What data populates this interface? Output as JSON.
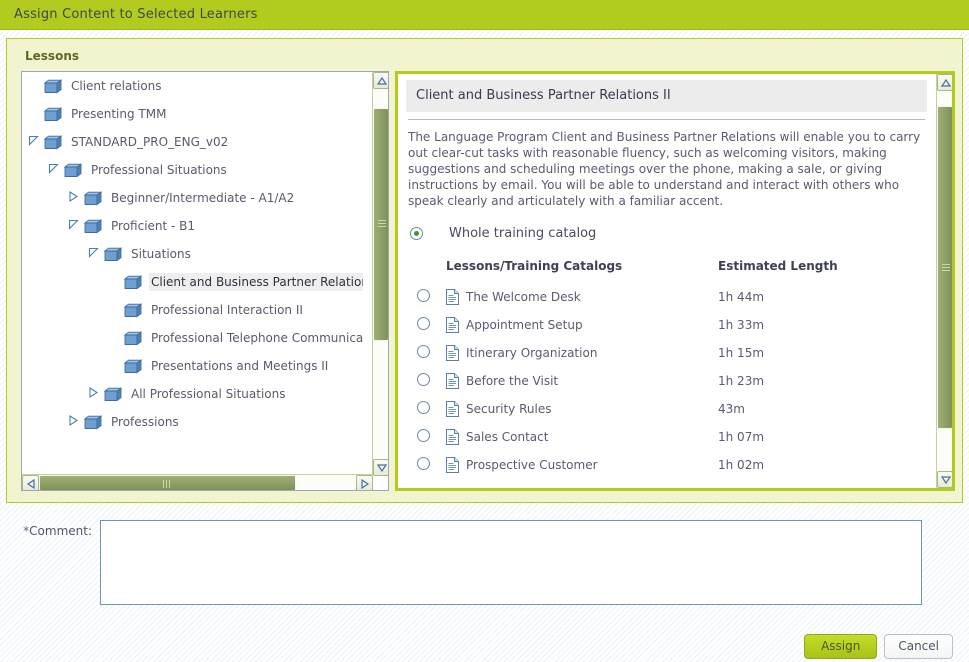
{
  "window": {
    "title": "Assign Content to Selected Learners",
    "title_bg": "#b3ca1f"
  },
  "panel": {
    "legend": "Lessons",
    "bg": "#f1f4cf",
    "border": "#b3ca1f"
  },
  "tree": {
    "items": [
      {
        "label": "Client relations",
        "depth": 1,
        "twisty": "none",
        "selected": false,
        "icon": "folder-icon"
      },
      {
        "label": "Presenting TMM",
        "depth": 1,
        "twisty": "none",
        "selected": false,
        "icon": "folder-icon"
      },
      {
        "label": "STANDARD_PRO_ENG_v02",
        "depth": 1,
        "twisty": "expanded",
        "selected": false,
        "icon": "folder-icon"
      },
      {
        "label": "Professional Situations",
        "depth": 2,
        "twisty": "expanded",
        "selected": false,
        "icon": "folder-icon"
      },
      {
        "label": "Beginner/Intermediate - A1/A2",
        "depth": 3,
        "twisty": "collapsed",
        "selected": false,
        "icon": "folder-icon"
      },
      {
        "label": "Proficient - B1",
        "depth": 3,
        "twisty": "expanded",
        "selected": false,
        "icon": "folder-icon"
      },
      {
        "label": "Situations",
        "depth": 4,
        "twisty": "expanded",
        "selected": false,
        "icon": "folder-icon"
      },
      {
        "label": "Client and Business Partner Relations II",
        "depth": 5,
        "twisty": "none",
        "selected": true,
        "icon": "folder-icon"
      },
      {
        "label": "Professional Interaction II",
        "depth": 5,
        "twisty": "none",
        "selected": false,
        "icon": "folder-icon"
      },
      {
        "label": "Professional Telephone Communication II",
        "depth": 5,
        "twisty": "none",
        "selected": false,
        "icon": "folder-icon"
      },
      {
        "label": "Presentations and Meetings II",
        "depth": 5,
        "twisty": "none",
        "selected": false,
        "icon": "folder-icon"
      },
      {
        "label": "All Professional Situations",
        "depth": 4,
        "twisty": "collapsed",
        "selected": false,
        "icon": "folder-icon"
      },
      {
        "label": "Professions",
        "depth": 3,
        "twisty": "collapsed",
        "selected": false,
        "icon": "folder-icon"
      }
    ],
    "vscroll": {
      "thumb_top_pct": 5,
      "thumb_height_pct": 63
    },
    "hscroll": {
      "thumb_left_pct": 0,
      "thumb_width_pct": 81
    }
  },
  "detail": {
    "heading": "Client and Business Partner Relations II",
    "description": "The Language Program Client and Business Partner Relations will enable you to carry out clear-cut tasks with reasonable fluency, such as welcoming visitors, making suggestions and scheduling meetings over the phone, making a sale, or giving instructions by email. You will be able to understand and interact with others who speak clearly and articulately with a familiar accent.",
    "whole_catalog": {
      "label": "Whole training catalog",
      "selected": true
    },
    "columns": {
      "radio": "",
      "name": "Lessons/Training Catalogs",
      "length": "Estimated Length"
    },
    "rows": [
      {
        "name": "The Welcome Desk",
        "length": "1h 44m",
        "selected": false,
        "icon": "document-icon"
      },
      {
        "name": "Appointment Setup",
        "length": "1h 33m",
        "selected": false,
        "icon": "document-icon"
      },
      {
        "name": "Itinerary Organization",
        "length": "1h 15m",
        "selected": false,
        "icon": "document-icon"
      },
      {
        "name": "Before the Visit",
        "length": "1h 23m",
        "selected": false,
        "icon": "document-icon"
      },
      {
        "name": "Security Rules",
        "length": "43m",
        "selected": false,
        "icon": "document-icon"
      },
      {
        "name": "Sales Contact",
        "length": "1h 07m",
        "selected": false,
        "icon": "document-icon"
      },
      {
        "name": "Prospective Customer",
        "length": "1h 02m",
        "selected": false,
        "icon": "document-icon"
      }
    ],
    "vscroll": {
      "thumb_top_pct": 4,
      "thumb_height_pct": 85
    }
  },
  "comment": {
    "required_marker": "*",
    "label": "Comment:",
    "value": "",
    "placeholder": ""
  },
  "footer": {
    "assign_label": "Assign",
    "cancel_label": "Cancel",
    "assign_color": "#b3ca1f"
  }
}
